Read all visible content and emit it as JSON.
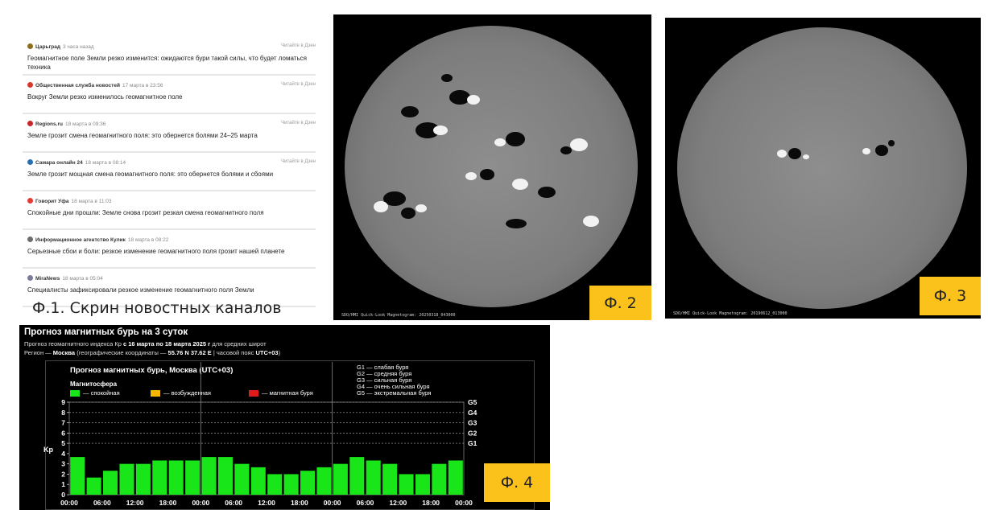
{
  "news": [
    {
      "source": "Царьград",
      "time": "3 часа назад",
      "read": "Читайте в Дзен",
      "title": "Геомагнитное поле Земли резко изменится: ожидаются бури такой силы, что будет ломаться техника",
      "icon_color": "#8a6d1d"
    },
    {
      "source": "Общественная служба новостей",
      "time": "17 марта в 23:56",
      "read": "Читайте в Дзен",
      "title": "Вокруг Земли резко изменилось геомагнитное поле",
      "icon_color": "#d63a2f"
    },
    {
      "source": "Regions.ru",
      "time": "18 марта в 09:36",
      "read": "Читайте в Дзен",
      "title": "Земле грозит смена геомагнитного поля: это обернется болями 24–25 марта",
      "icon_color": "#c62828"
    },
    {
      "source": "Самара онлайн 24",
      "time": "18 марта в 08:14",
      "read": "Читайте в Дзен",
      "title": "Земле грозит мощная смена геомагнитного поля: это обернется болями и сбоями",
      "icon_color": "#2a6fb0"
    },
    {
      "source": "Говорит Уфа",
      "time": "18 марта в 11:03",
      "read": "",
      "title": "Спокойные дни прошли: Земле снова грозит резкая смена геомагнитного поля",
      "icon_color": "#e53935"
    },
    {
      "source": "Информационное агентство Кулик",
      "time": "18 марта в 08:22",
      "read": "",
      "title": "Серьезные сбои и боли: резкое изменение геомагнитного поля грозит нашей планете",
      "icon_color": "#6d6d6d"
    },
    {
      "source": "MiraNews",
      "time": "18 марта в 05:04",
      "read": "",
      "title": "Специалисты зафиксировали резкое изменение геомагнитного поля Земли",
      "icon_color": "#7a7a9a"
    }
  ],
  "captions": {
    "f1": "Ф.1. Скрин новостных каналов",
    "f2": "Ф. 2",
    "f3": "Ф. 3",
    "f4": "Ф. 4"
  },
  "magnetograms": {
    "f2_label": "SDO/HMI Quick-Look Magnetogram: 20250318_043000",
    "f3_label": "SDO/HMI Quick-Look Magnetogram: 20190612_013000"
  },
  "forecast": {
    "title": "Прогноз магнитных бурь на 3 суток",
    "subtitle_prefix": "Прогноз геомагнитного индекса Кр",
    "subtitle_range": "с 16 марта по 18 марта 2025 г",
    "subtitle_suffix": "для средних широт",
    "region_prefix": "Регион —",
    "region_name": "Москва",
    "region_coords_label": "(географические координаты —",
    "region_coords": "55.76 N 37.62 E",
    "region_tz_label": "| часовой пояс",
    "region_tz": "UTC+03",
    "region_end": ")",
    "chart_title": "Прогноз магнитных бурь, Москва (UTC+03)",
    "magnetosphere_label": "Магнитосфера",
    "legend": [
      {
        "label": "— спокойная",
        "color": "#19e619"
      },
      {
        "label": "— возбужденная",
        "color": "#f5b800"
      },
      {
        "label": "— магнитная буря",
        "color": "#e01b1b"
      }
    ],
    "g_scale": [
      "G1 — слабая буря",
      "G2 — средняя буря",
      "G3 — сильная буря",
      "G4 — очень сильная буря",
      "G5 — экстремальная буря"
    ]
  },
  "chart_data": {
    "type": "bar",
    "ylabel": "Kp",
    "ylim": [
      0,
      9
    ],
    "yticks": [
      "0",
      "1",
      "2",
      "3",
      "4",
      "5",
      "6",
      "7",
      "8",
      "9"
    ],
    "right_ticks": [
      {
        "label": "G1",
        "value": 5
      },
      {
        "label": "G2",
        "value": 6
      },
      {
        "label": "G3",
        "value": 7
      },
      {
        "label": "G4",
        "value": 8
      },
      {
        "label": "G5",
        "value": 9
      }
    ],
    "xticks": [
      "00:00",
      "06:00",
      "12:00",
      "18:00",
      "00:00",
      "06:00",
      "12:00",
      "18:00",
      "00:00",
      "06:00",
      "12:00",
      "18:00",
      "00:00"
    ],
    "values": [
      3.67,
      1.67,
      2.33,
      3.0,
      3.0,
      3.33,
      3.33,
      3.33,
      3.67,
      3.67,
      3.0,
      2.67,
      2.0,
      2.0,
      2.33,
      2.67,
      3.0,
      3.67,
      3.33,
      3.0,
      2.0,
      2.0,
      3.0,
      3.33
    ],
    "bar_color": "#19e619",
    "grid": true
  }
}
